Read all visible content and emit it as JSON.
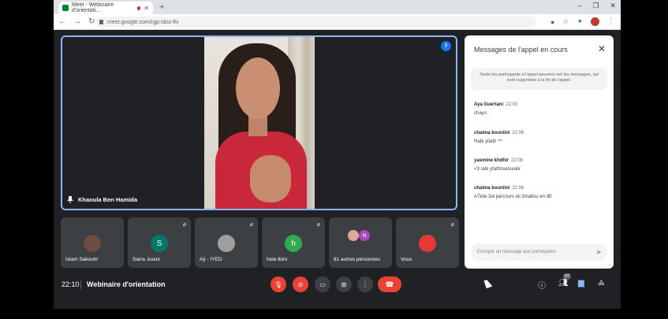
{
  "browser": {
    "tab_title": "Meet - Webinaire d'orientati...",
    "url": "meet.google.com/rgp-sbui-ftv",
    "new_tab": "+",
    "win_controls": [
      "–",
      "❐",
      "✕"
    ]
  },
  "main_video": {
    "speaker_name": "Khaoula Ben Hamida"
  },
  "tiles": [
    {
      "name": "Islam Sakouhi",
      "avatar_type": "photo",
      "avatar_color": "#6d4c41",
      "initial": ""
    },
    {
      "name": "Sarra Jouini",
      "avatar_type": "initial",
      "avatar_color": "#00796b",
      "initial": "S"
    },
    {
      "name": "Aÿ - IYED",
      "avatar_type": "photo",
      "avatar_color": "#9e9e9e",
      "initial": ""
    },
    {
      "name": "hela tbini",
      "avatar_type": "initial",
      "avatar_color": "#33a853",
      "initial": "h"
    },
    {
      "name": "81 autres personnes",
      "avatar_type": "group",
      "avatar_color": "#ab47bc",
      "initial": "N"
    },
    {
      "name": "Vous",
      "avatar_type": "photo",
      "avatar_color": "#e53935",
      "initial": ""
    }
  ],
  "chat": {
    "title": "Messages de l'appel en cours",
    "notice": "Seuls les participants à l'appel peuvent voir les messages, qui sont supprimés à la fin de l'appel.",
    "messages": [
      {
        "sender": "Aya Guertani",
        "time": "22:03",
        "text": "chayo"
      },
      {
        "sender": "chaima kouniini",
        "time": "22:06",
        "text": "Rabi yfatih ^^"
      },
      {
        "sender": "yasmine khdhir",
        "time": "22:06",
        "text": "<3 rabi yfathloulouukk"
      },
      {
        "sender": "chaima kouniini",
        "time": "22:06",
        "text": "A7kila 3al parcours eli 3maltou en dft"
      }
    ],
    "compose_placeholder": "Envoyer un message aux participants"
  },
  "bottom_bar": {
    "time": "22:10",
    "meeting_title": "Webinaire d'orientation",
    "participants_count": "87"
  },
  "colors": {
    "accent": "#8ab4f8",
    "danger": "#ea4335",
    "background": "#202124",
    "tile": "#3c4043"
  }
}
